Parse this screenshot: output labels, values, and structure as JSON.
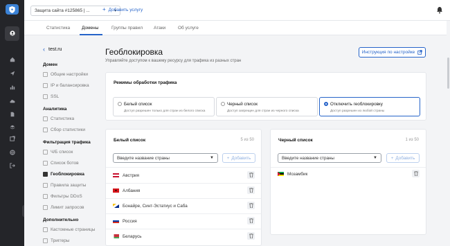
{
  "topbar": {
    "site_select": "Защита сайта #125865 | ...",
    "add_service": "Добавить услугу"
  },
  "tabs": [
    {
      "label": "Статистика"
    },
    {
      "label": "Домены",
      "active": true
    },
    {
      "label": "Группы правил"
    },
    {
      "label": "Атаки"
    },
    {
      "label": "Об услуге"
    }
  ],
  "subnav": {
    "domain": "test.ru",
    "sections": [
      {
        "title": "Домен",
        "items": [
          "Общие настройки",
          "IP и балансировка",
          "SSL"
        ]
      },
      {
        "title": "Аналитика",
        "items": [
          "Статистика",
          "Сбор статистики"
        ]
      },
      {
        "title": "Фильтрация трафика",
        "items": [
          "Ч/Б список",
          "Список ботов",
          "Геоблокировка",
          "Правила защиты",
          "Фильтры DDoS",
          "Лимит запросов"
        ]
      },
      {
        "title": "Дополнительно",
        "items": [
          "Кастомные страницы",
          "Триггеры"
        ]
      }
    ],
    "active_item": "Геоблокировка"
  },
  "page": {
    "title": "Геоблокировка",
    "subtitle": "Управляйте доступом к вашему ресурсу для трафика из разных стран",
    "guide_button": "Инструкция по настройке"
  },
  "modes": {
    "title": "Режимы обработки трафика",
    "options": [
      {
        "label": "Белый список",
        "desc": "Доступ разрешен только для стран из белого списка",
        "selected": false
      },
      {
        "label": "Черный список",
        "desc": "Доступ запрещен для стран из черного списка",
        "selected": false
      },
      {
        "label": "Отключить геоблокировку",
        "desc": "Доступ разрешен из любой страны",
        "selected": true
      }
    ]
  },
  "whitelist": {
    "title": "Белый список",
    "count": "5 из 50",
    "placeholder": "Введите название страны",
    "add": "Добавить",
    "rows": [
      {
        "name": "Австрия",
        "flag": "austria"
      },
      {
        "name": "Албания",
        "flag": "albania"
      },
      {
        "name": "Бонайре, Синт-Эстатиус и Саба",
        "flag": "bonaire"
      },
      {
        "name": "Россия",
        "flag": "russia"
      },
      {
        "name": "Беларусь",
        "flag": "belarus"
      }
    ]
  },
  "blacklist": {
    "title": "Черный список",
    "count": "1 из 50",
    "placeholder": "Введите название страны",
    "add": "Добавить",
    "rows": [
      {
        "name": "Мозамбик",
        "flag": "mozambique"
      }
    ]
  },
  "colors": {
    "accent": "#2563c9",
    "rail": "#242529"
  },
  "icons": [
    "shield-logo-icon",
    "user-circle-icon",
    "home-icon",
    "send-icon",
    "chart-icon",
    "cloud-icon",
    "document-icon",
    "layers-icon",
    "external-link-icon",
    "globe-icon",
    "logout-icon",
    "bell-icon",
    "trash-icon"
  ]
}
